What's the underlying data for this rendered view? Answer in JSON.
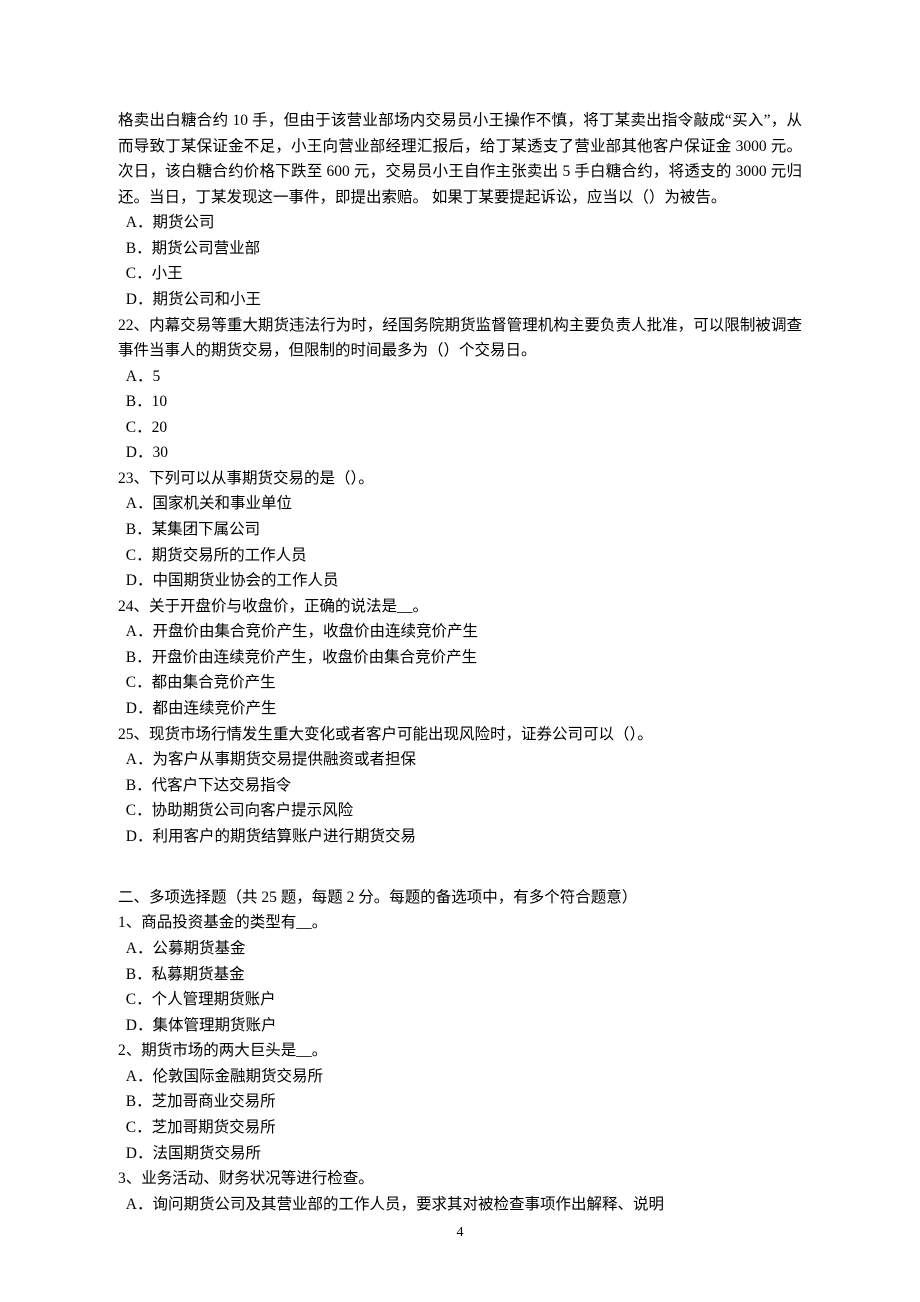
{
  "intro": [
    "格卖出白糖合约 10 手，但由于该营业部场内交易员小王操作不慎，将丁某卖出指令敲成“买入”，从而导致丁某保证金不足，小王向营业部经理汇报后，给丁某透支了营业部其他客户保证金 3000 元。次日，该白糖合约价格下跌至 600 元，交易员小王自作主张卖出 5 手白糖合约，将透支的 3000 元归还。当日，丁某发现这一事件，即提出索赔。 如果丁某要提起诉讼，应当以（）为被告。"
  ],
  "q21": {
    "a": "A．期货公司",
    "b": "B．期货公司营业部",
    "c": "C．小王",
    "d": "D．期货公司和小王"
  },
  "q22": {
    "stem": "22、内幕交易等重大期货违法行为时，经国务院期货监督管理机构主要负责人批准，可以限制被调查事件当事人的期货交易，但限制的时间最多为（）个交易日。",
    "a": "A．5",
    "b": "B．10",
    "c": "C．20",
    "d": "D．30"
  },
  "q23": {
    "stem": "23、下列可以从事期货交易的是（）。",
    "a": "A．国家机关和事业单位",
    "b": "B．某集团下属公司",
    "c": "C．期货交易所的工作人员",
    "d": "D．中国期货业协会的工作人员"
  },
  "q24": {
    "stem": "24、关于开盘价与收盘价，正确的说法是__。",
    "a": "A．开盘价由集合竞价产生，收盘价由连续竞价产生",
    "b": "B．开盘价由连续竞价产生，收盘价由集合竞价产生",
    "c": "C．都由集合竞价产生",
    "d": "D．都由连续竞价产生"
  },
  "q25": {
    "stem": "25、现货市场行情发生重大变化或者客户可能出现风险时，证券公司可以（）。",
    "a": "A．为客户从事期货交易提供融资或者担保",
    "b": "B．代客户下达交易指令",
    "c": "C．协助期货公司向客户提示风险",
    "d": "D．利用客户的期货结算账户进行期货交易"
  },
  "section2": {
    "title": "二、多项选择题（共 25 题，每题 2 分。每题的备选项中，有多个符合题意）"
  },
  "mq1": {
    "stem": "1、商品投资基金的类型有__。",
    "a": "A．公募期货基金",
    "b": "B．私募期货基金",
    "c": "C．个人管理期货账户",
    "d": "D．集体管理期货账户"
  },
  "mq2": {
    "stem": "2、期货市场的两大巨头是__。",
    "a": "A．伦敦国际金融期货交易所",
    "b": "B．芝加哥商业交易所",
    "c": "C．芝加哥期货交易所",
    "d": "D．法国期货交易所"
  },
  "mq3": {
    "stem": "3、业务活动、财务状况等进行检查。",
    "a": "A．询问期货公司及其营业部的工作人员，要求其对被检查事项作出解释、说明"
  },
  "pageNumber": "4"
}
